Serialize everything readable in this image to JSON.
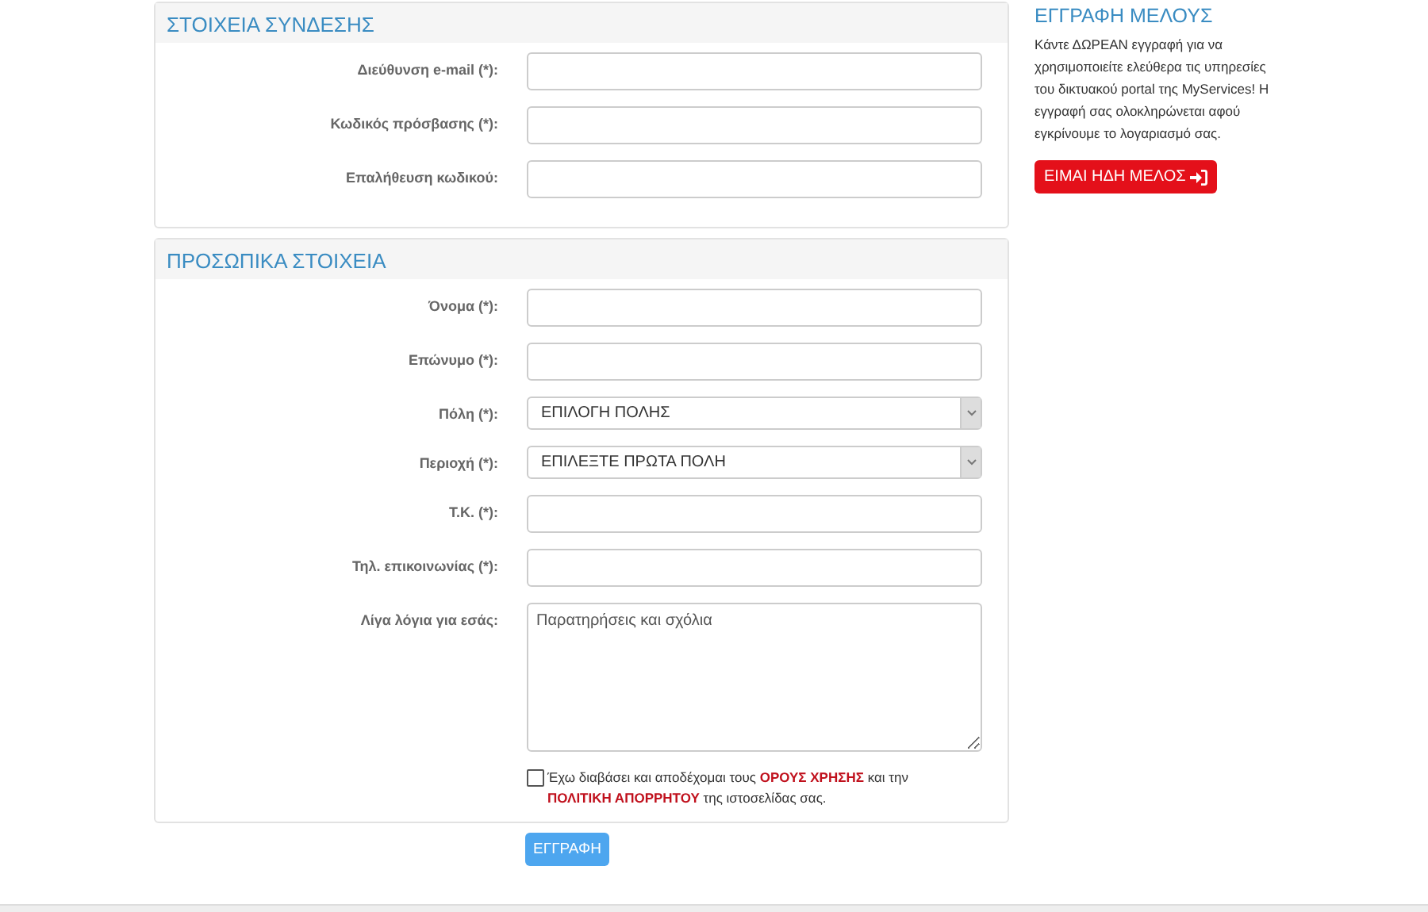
{
  "sections": [
    {
      "title": "ΣΤΟΙΧΕΙΑ ΣΥΝΔΕΣΗΣ",
      "fields": [
        {
          "kind": "text",
          "label": "Διεύθυνση e-mail (*):"
        },
        {
          "kind": "text",
          "label": "Κωδικός πρόσβασης (*):"
        },
        {
          "kind": "text",
          "label": "Επαλήθευση κωδικού:"
        }
      ]
    },
    {
      "title": "ΠΡΟΣΩΠΙΚΑ ΣΤΟΙΧΕΙΑ",
      "fields": [
        {
          "kind": "text",
          "label": "Όνομα (*):"
        },
        {
          "kind": "text",
          "label": "Επώνυμο (*):"
        },
        {
          "kind": "select",
          "label": "Πόλη (*):",
          "value": "ΕΠΙΛΟΓΗ ΠΟΛΗΣ"
        },
        {
          "kind": "select",
          "label": "Περιοχή (*):",
          "value": "ΕΠΙΛΕΞΤΕ ΠΡΩΤΑ ΠΟΛΗ"
        },
        {
          "kind": "text",
          "label": "Τ.Κ. (*):"
        },
        {
          "kind": "text",
          "label": "Τηλ. επικοινωνίας (*):"
        },
        {
          "kind": "textarea",
          "label": "Λίγα λόγια για εσάς:",
          "placeholder": "Παρατηρήσεις και σχόλια"
        }
      ],
      "terms": {
        "checked": false,
        "text": "Έχω διαβάσει και αποδέχομαι τους **ΟΡΟΥΣ ΧΡΗΣΗΣ** και την **ΠΟΛΙΤΙΚΗ ΑΠΟΡΡΗΤΟΥ** της ιστοσελίδας σας."
      }
    }
  ],
  "submit": "ΕΓΓΡΑΦΗ",
  "sidebar": {
    "title": "ΕΓΓΡΑΦΗ ΜΕΛΟΥΣ",
    "text": "Κάντε ΔΩΡΕΑΝ εγγραφή για να χρησιμοποιείτε ελεύθερα τις υπηρεσίες του δικτυακού portal της MyServices! Η εγγραφή σας ολοκληρώνεται αφού εγκρίνουμε το λογαριασμό σας.",
    "button": "ΕΙΜΑΙ ΗΔΗ ΜΕΛΟΣ"
  }
}
